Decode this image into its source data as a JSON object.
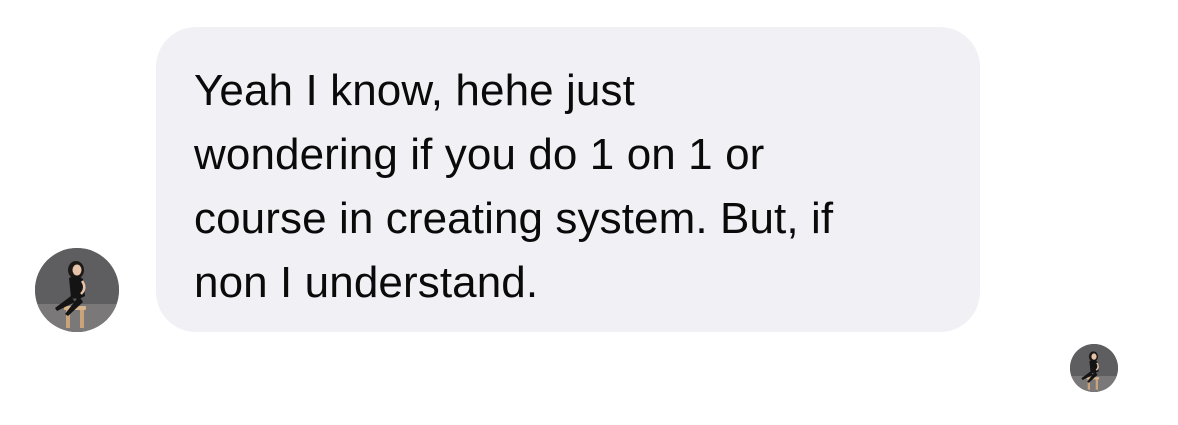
{
  "conversation": {
    "message": {
      "text": "Yeah I know, hehe just\nwondering if you do 1 on 1 or\ncourse in creating system. But, if\nnon I understand."
    },
    "sender_avatar": {
      "icon": "profile-photo"
    },
    "seen_avatar": {
      "icon": "profile-photo"
    }
  },
  "colors": {
    "bubble_background": "#f1f1f5",
    "text": "#0a0a0a",
    "avatar_background": "#5f5f5f"
  }
}
